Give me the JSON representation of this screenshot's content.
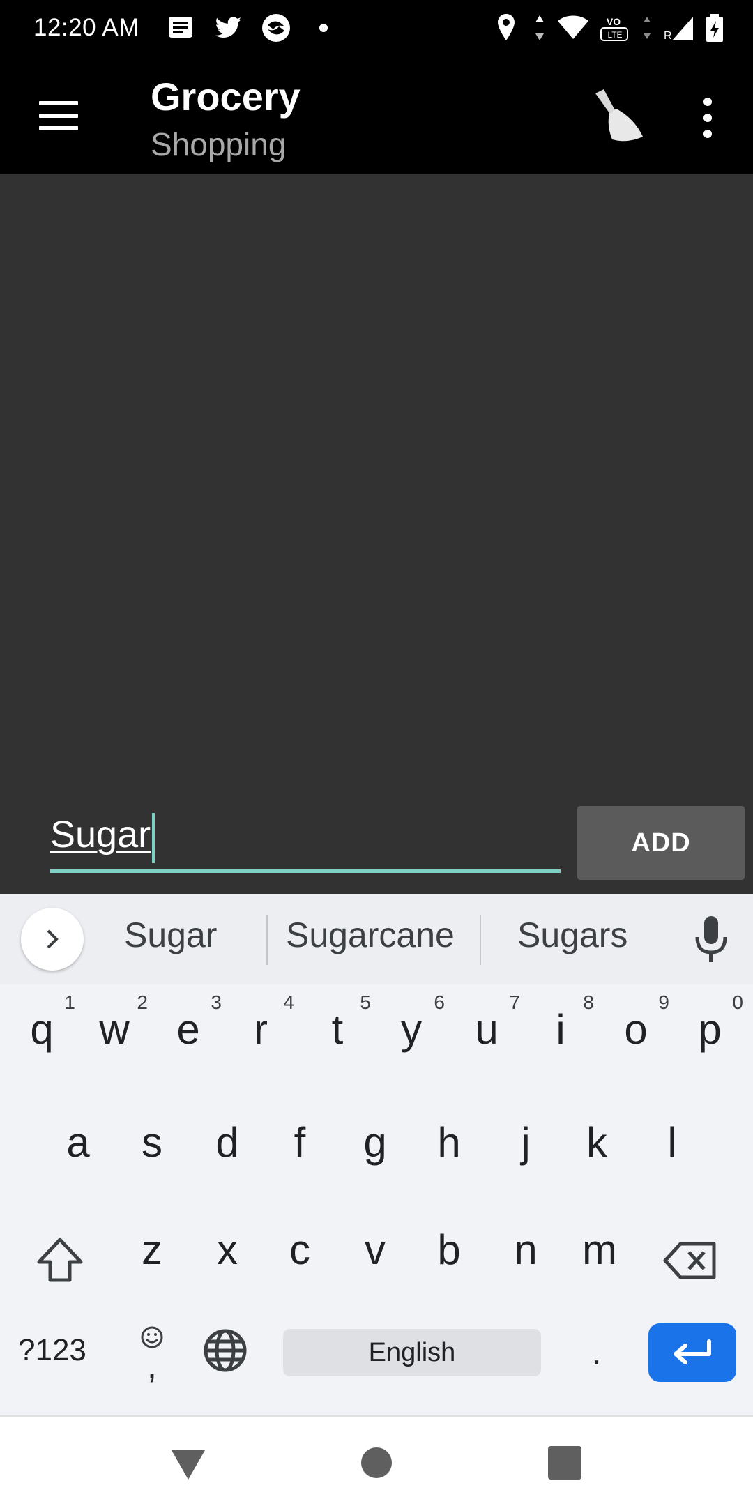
{
  "status_bar": {
    "time": "12:20 AM",
    "notification_icons": [
      "message-icon",
      "twitter-icon",
      "app-icon",
      "dot-icon"
    ],
    "system_icons": [
      "location-icon",
      "data-arrows-icon",
      "wifi-icon",
      "volte-icon",
      "signal-icon",
      "battery-icon"
    ],
    "volte_label": "VO LTE",
    "roaming_label": "R"
  },
  "app_bar": {
    "title": "Grocery",
    "subtitle": "Shopping"
  },
  "input": {
    "value": "Sugar"
  },
  "add_button": {
    "label": "ADD"
  },
  "keyboard": {
    "suggestions": [
      "Sugar",
      "Sugarcane",
      "Sugars"
    ],
    "row1": [
      {
        "key": "q",
        "hint": "1"
      },
      {
        "key": "w",
        "hint": "2"
      },
      {
        "key": "e",
        "hint": "3"
      },
      {
        "key": "r",
        "hint": "4"
      },
      {
        "key": "t",
        "hint": "5"
      },
      {
        "key": "y",
        "hint": "6"
      },
      {
        "key": "u",
        "hint": "7"
      },
      {
        "key": "i",
        "hint": "8"
      },
      {
        "key": "o",
        "hint": "9"
      },
      {
        "key": "p",
        "hint": "0"
      }
    ],
    "row2": [
      "a",
      "s",
      "d",
      "f",
      "g",
      "h",
      "j",
      "k",
      "l"
    ],
    "row3": [
      "z",
      "x",
      "c",
      "v",
      "b",
      "n",
      "m"
    ],
    "symbols_label": "?123",
    "comma_label": ",",
    "space_label": "English",
    "period_label": ".",
    "accent_color": "#1a73e8"
  },
  "colors": {
    "app_bar_bg": "#000000",
    "content_bg": "#323232",
    "input_accent": "#7ed0c4",
    "add_button_bg": "#5b5b5b"
  }
}
